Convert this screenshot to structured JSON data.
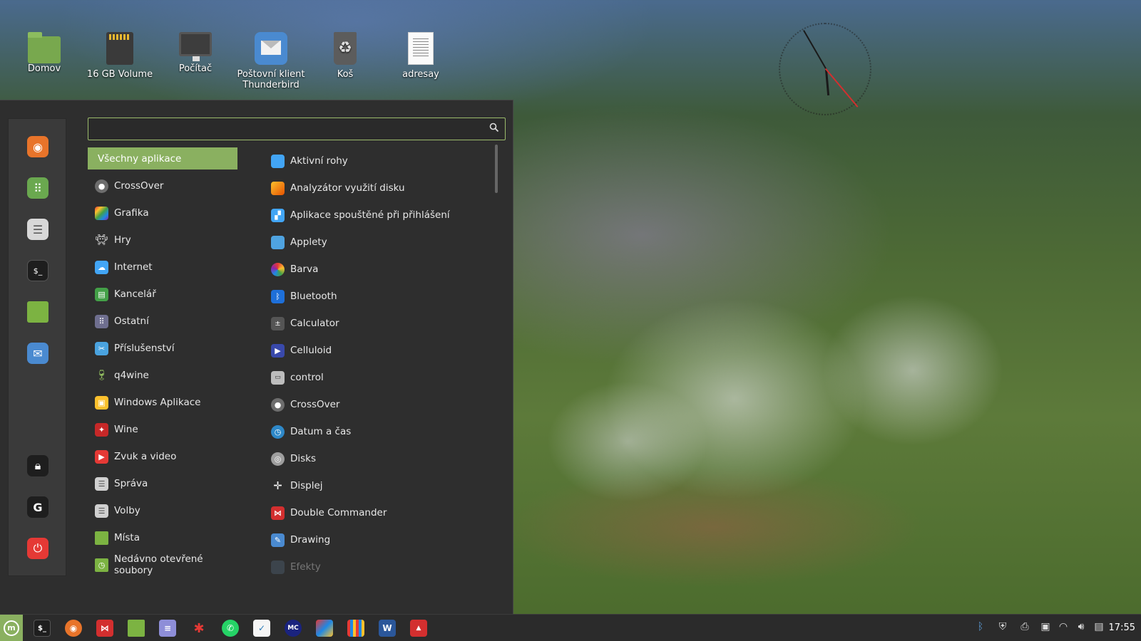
{
  "desktop": {
    "icons": [
      {
        "label": "Domov",
        "icon": "home-folder-icon"
      },
      {
        "label": "16 GB Volume",
        "icon": "sd-card-icon"
      },
      {
        "label": "Počítač",
        "icon": "computer-icon"
      },
      {
        "label": "Poštovní klient Thunderbird",
        "icon": "mail-icon"
      },
      {
        "label": "Koš",
        "icon": "trash-icon"
      },
      {
        "label": "adresay",
        "icon": "document-icon"
      }
    ]
  },
  "menu": {
    "search": {
      "value": "",
      "placeholder": ""
    },
    "favorites": [
      {
        "icon": "firefox-icon",
        "color": "#e8742a"
      },
      {
        "icon": "software-manager-icon",
        "color": "#6aa84f"
      },
      {
        "icon": "settings-icon",
        "color": "#d8d8d8"
      },
      {
        "icon": "terminal-icon",
        "color": "#1e1e1e"
      },
      {
        "icon": "folder-icon",
        "color": "#7cb342"
      },
      {
        "icon": "mail-icon",
        "color": "#4a8ad0"
      }
    ],
    "session": [
      {
        "icon": "lock-icon"
      },
      {
        "icon": "logout-icon"
      },
      {
        "icon": "power-icon",
        "color": "#e53935"
      }
    ],
    "categories": [
      "Všechny aplikace",
      "CrossOver",
      "Grafika",
      "Hry",
      "Internet",
      "Kancelář",
      "Ostatní",
      "Příslušenství",
      "q4wine",
      "Windows Aplikace",
      "Wine",
      "Zvuk a video",
      "Správa",
      "Volby",
      "Místa",
      "Nedávno otevřené soubory"
    ],
    "apps": [
      "Aktivní rohy",
      "Analyzátor využití disku",
      "Aplikace spouštěné při přihlášení",
      "Applety",
      "Barva",
      "Bluetooth",
      "Calculator",
      "Celluloid",
      "control",
      "CrossOver",
      "Datum a čas",
      "Disks",
      "Displej",
      "Double Commander",
      "Drawing",
      "Efekty"
    ]
  },
  "taskbar": {
    "apps": [
      "terminal-icon",
      "firefox-icon",
      "double-commander-icon",
      "files-icon",
      "text-editor-icon",
      "bug-icon",
      "whatsapp-icon",
      "vidcutter-icon",
      "multicommander-icon",
      "libreoffice-icon",
      "calendar-icon",
      "word-icon",
      "pdf-icon"
    ],
    "time": "17:55"
  },
  "colors": {
    "accent": "#8ab060",
    "menu_bg": "#2e2e2e"
  }
}
